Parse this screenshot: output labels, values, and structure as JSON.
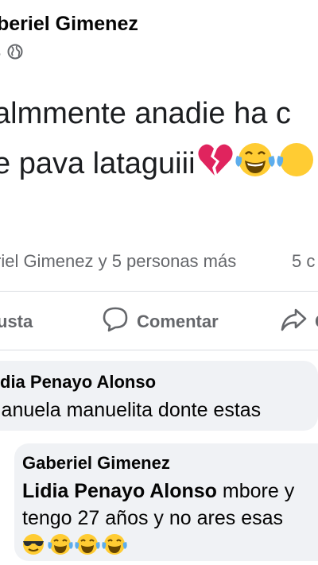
{
  "post": {
    "author": "beriel Gimenez",
    "meta_dot": "·",
    "line1": "almmente anadie ha c",
    "line2": "e  pava lataguiii",
    "line2_emojis": [
      "broken-heart-icon",
      "tears-of-joy-icon",
      "tears-of-joy-icon"
    ]
  },
  "stats": {
    "reactions": "riel Gimenez y 5 personas más",
    "comments": "5 c"
  },
  "actions": {
    "like": "usta",
    "comment": "Comentar",
    "share": "C"
  },
  "comments": [
    {
      "author": "dia Penayo Alonso",
      "text": "lanuela   manuelita donte estas"
    },
    {
      "author": "Gaberiel Gimenez",
      "mention": "Lidia Penayo Alonso",
      "text1_rest": " mbore y",
      "text2": "tengo 27 años y no ares esas",
      "emojis": [
        "sunglasses-face-icon",
        "tears-of-joy-icon",
        "tears-of-joy-icon",
        "tears-of-joy-icon"
      ]
    }
  ],
  "colors": {
    "text": "#050505",
    "secondary": "#65676b",
    "bubble": "#f0f2f5",
    "divider": "#dadde1",
    "emoji_yellow": "#ffcc33",
    "heart_red": "#e0245e"
  }
}
